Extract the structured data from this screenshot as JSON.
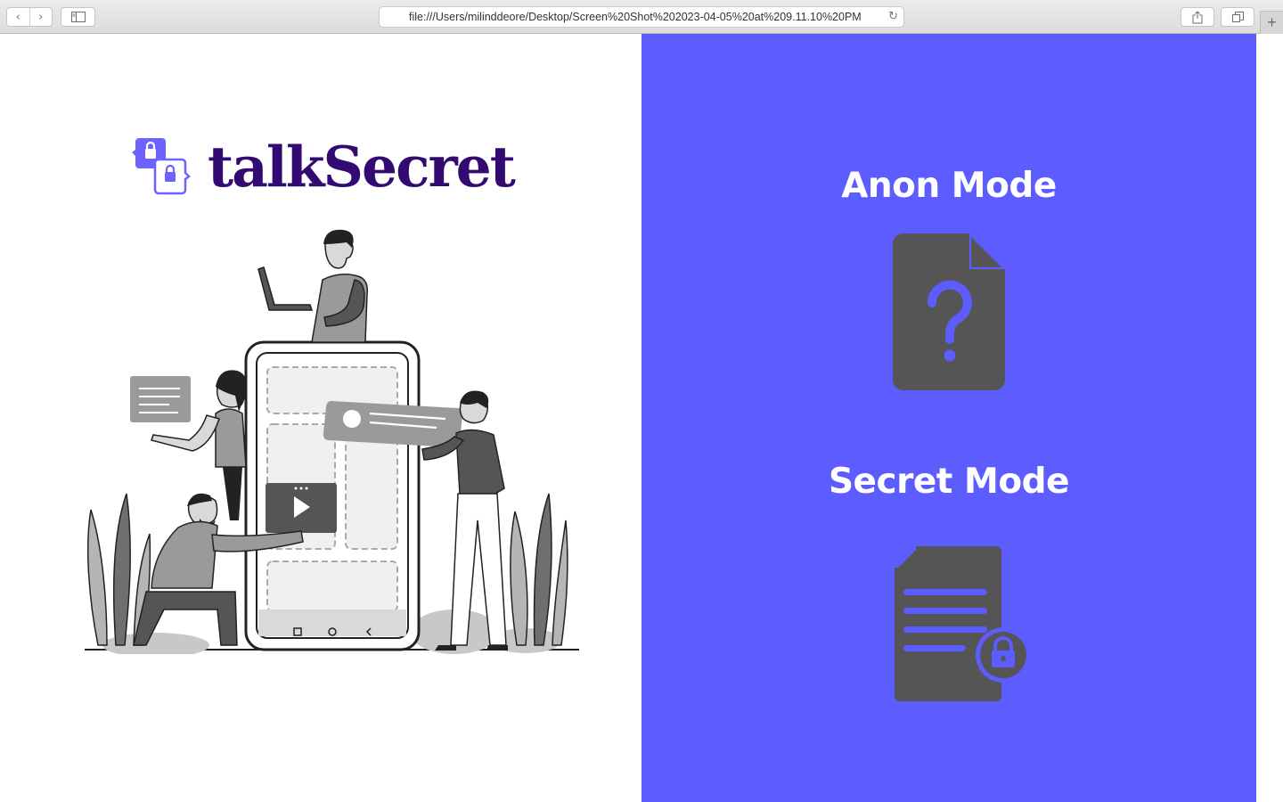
{
  "browser": {
    "url": "file:///Users/milinddeore/Desktop/Screen%20Shot%202023-04-05%20at%209.11.10%20PM",
    "back_icon": "chevron-left-icon",
    "forward_icon": "chevron-right-icon",
    "sidebar_icon": "sidebar-icon",
    "reload_icon": "reload-icon",
    "share_icon": "share-icon",
    "tabs_icon": "tabs-icon",
    "new_tab_icon": "plus-icon"
  },
  "brand": {
    "name": "talkSecret",
    "color": "#330a72",
    "logo_icon": "chat-lock-icon",
    "logo_color": "#6c63ff"
  },
  "hero": {
    "illustration": "people-with-phone-illustration"
  },
  "modes": {
    "background": "#5c5cff",
    "icon_color": "#555555",
    "anon": {
      "label": "Anon Mode",
      "icon": "file-question-icon"
    },
    "secret": {
      "label": "Secret Mode",
      "icon": "file-lock-icon"
    }
  }
}
